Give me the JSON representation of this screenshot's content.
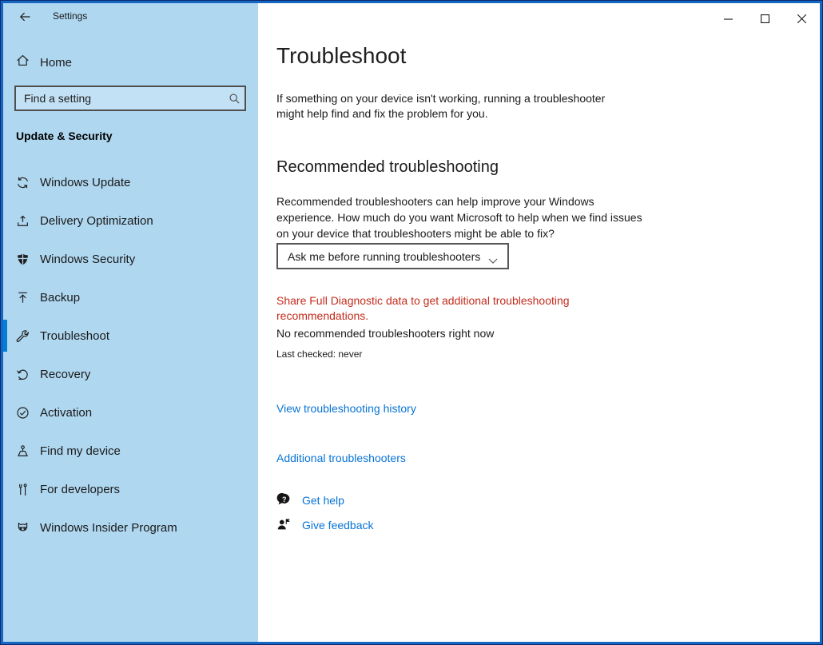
{
  "window": {
    "title": "Settings",
    "controls": {
      "minimize": "minimize",
      "maximize": "maximize",
      "close": "close"
    }
  },
  "sidebar": {
    "home_label": "Home",
    "search_placeholder": "Find a setting",
    "section_heading": "Update & Security",
    "items": [
      {
        "label": "Windows Update",
        "icon": "windows-update-icon",
        "selected": false
      },
      {
        "label": "Delivery Optimization",
        "icon": "delivery-optimization-icon",
        "selected": false
      },
      {
        "label": "Windows Security",
        "icon": "windows-security-icon",
        "selected": false
      },
      {
        "label": "Backup",
        "icon": "backup-icon",
        "selected": false
      },
      {
        "label": "Troubleshoot",
        "icon": "troubleshoot-icon",
        "selected": true
      },
      {
        "label": "Recovery",
        "icon": "recovery-icon",
        "selected": false
      },
      {
        "label": "Activation",
        "icon": "activation-icon",
        "selected": false
      },
      {
        "label": "Find my device",
        "icon": "find-my-device-icon",
        "selected": false
      },
      {
        "label": "For developers",
        "icon": "for-developers-icon",
        "selected": false
      },
      {
        "label": "Windows Insider Program",
        "icon": "windows-insider-icon",
        "selected": false
      }
    ]
  },
  "main": {
    "title": "Troubleshoot",
    "intro": "If something on your device isn't working, running a troubleshooter might help find and fix the problem for you.",
    "recommended": {
      "heading": "Recommended troubleshooting",
      "description": "Recommended troubleshooters can help improve your Windows experience. How much do you want Microsoft to help when we find issues on your device that troubleshooters might be able to fix?",
      "dropdown_value": "Ask me before running troubleshooters",
      "warning": "Share Full Diagnostic data to get additional troubleshooting recommendations.",
      "status": "No recommended troubleshooters right now",
      "last_checked": "Last checked: never"
    },
    "links": {
      "history": "View troubleshooting history",
      "additional": "Additional troubleshooters"
    },
    "help": {
      "get_help": "Get help",
      "give_feedback": "Give feedback"
    }
  },
  "colors": {
    "accent": "#0080d9",
    "link": "#0873d6",
    "warning": "#c42b1c",
    "sidebar_bg": "#afd7f0",
    "window_border": "#1567c2"
  }
}
